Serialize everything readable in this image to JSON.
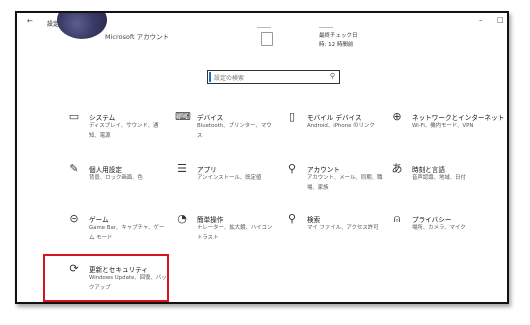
{
  "window": {
    "back_label": "←",
    "title": "設定",
    "minimize_label": "–",
    "maximize_label": "□"
  },
  "account": {
    "label": "Microsoft アカウント",
    "sync_line1": "最終チェック日",
    "sync_line2": "時: 12 時間前"
  },
  "search": {
    "placeholder": "設定の検索",
    "icon": "search-icon"
  },
  "tiles": [
    {
      "name": "システム",
      "desc": "ディスプレイ、サウンド、通知、電源",
      "icon": "laptop-icon",
      "glyph": "▭"
    },
    {
      "name": "デバイス",
      "desc": "Bluetooth、プリンター、マウス",
      "icon": "keyboard-icon",
      "glyph": "⌨"
    },
    {
      "name": "モバイル デバイス",
      "desc": "Android、iPhone のリンク",
      "icon": "phone-icon",
      "glyph": "▯"
    },
    {
      "name": "ネットワークとインターネット",
      "desc": "Wi-Fi、機内モード、VPN",
      "icon": "globe-icon",
      "glyph": "⊕"
    },
    {
      "name": "個人用設定",
      "desc": "背景、ロック画面、色",
      "icon": "paint-icon",
      "glyph": "✎"
    },
    {
      "name": "アプリ",
      "desc": "アンインストール、既定値",
      "icon": "apps-list-icon",
      "glyph": "☰"
    },
    {
      "name": "アカウント",
      "desc": "アカウント、メール、同期、職場、家族",
      "icon": "person-icon",
      "glyph": "⚲"
    },
    {
      "name": "時刻と言語",
      "desc": "音声認識、地域、日付",
      "icon": "language-icon",
      "glyph": "あ"
    },
    {
      "name": "ゲーム",
      "desc": "Game Bar、キャプチャ、ゲーム モード",
      "icon": "gamepad-icon",
      "glyph": "⊝"
    },
    {
      "name": "簡単操作",
      "desc": "ナレーター、拡大鏡、ハイコントラスト",
      "icon": "ease-of-access-icon",
      "glyph": "◔"
    },
    {
      "name": "検索",
      "desc": "マイ ファイル、アクセス許可",
      "icon": "search-icon",
      "glyph": "⚲"
    },
    {
      "name": "プライバシー",
      "desc": "場所、カメラ、マイク",
      "icon": "lock-icon",
      "glyph": "⍝"
    },
    {
      "name": "更新とセキュリティ",
      "desc": "Windows Update、回復、バックアップ",
      "icon": "update-icon",
      "glyph": "⟳"
    }
  ],
  "accent_color": "#d9141f"
}
